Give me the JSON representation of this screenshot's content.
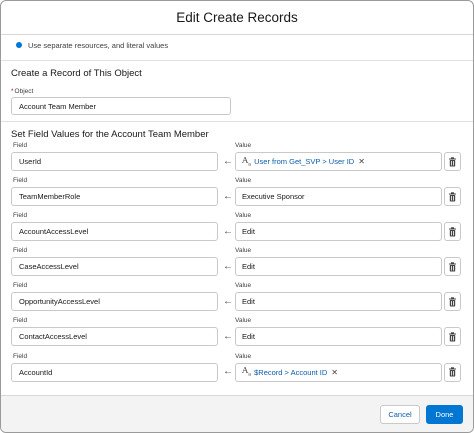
{
  "modal": {
    "title": "Edit Create Records",
    "radio_option": "Use separate resources, and literal values",
    "section_create": "Create a Record of This Object",
    "object_label": "Object",
    "object_required_mark": "*",
    "object_value": "Account Team Member",
    "section_fields": "Set Field Values for the Account Team Member",
    "field_col_label": "Field",
    "value_col_label": "Value",
    "rows": [
      {
        "field": "UserId",
        "value": "User from Get_SVP > User ID",
        "is_resource": true
      },
      {
        "field": "TeamMemberRole",
        "value": "Executive Sponsor",
        "is_resource": false
      },
      {
        "field": "AccountAccessLevel",
        "value": "Edit",
        "is_resource": false
      },
      {
        "field": "CaseAccessLevel",
        "value": "Edit",
        "is_resource": false
      },
      {
        "field": "OpportunityAccessLevel",
        "value": "Edit",
        "is_resource": false
      },
      {
        "field": "ContactAccessLevel",
        "value": "Edit",
        "is_resource": false
      },
      {
        "field": "AccountId",
        "value": "$Record > Account ID",
        "is_resource": true
      }
    ],
    "footer": {
      "cancel_label": "Cancel",
      "done_label": "Done"
    }
  },
  "icons": {
    "arrow": "left-arrow-icon",
    "resource": "text-resource-icon",
    "remove": "close-icon",
    "delete": "trash-icon"
  },
  "colors": {
    "brand": "#0176d3",
    "link": "#0b5cab",
    "required": "#ba0517"
  }
}
